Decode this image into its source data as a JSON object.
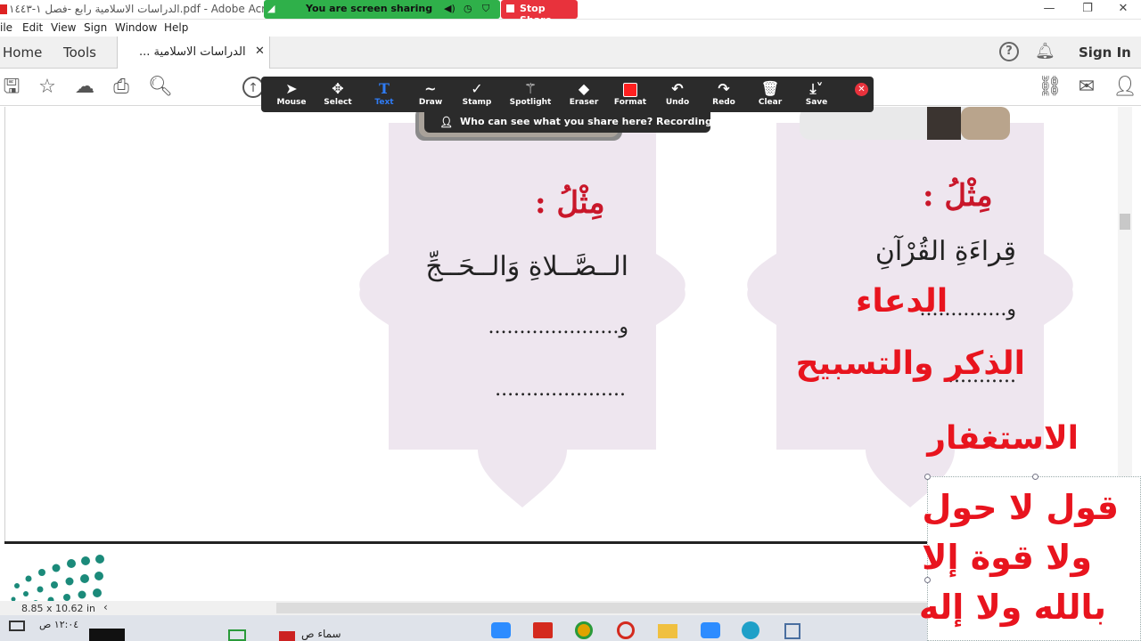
{
  "window": {
    "title": "الدراسات الاسلامية رابع -فصل ١-١٤٤٣.pdf - Adobe Acrobat Re",
    "menu": [
      "ile",
      "Edit",
      "View",
      "Sign",
      "Window",
      "Help"
    ]
  },
  "tabs": {
    "home": "Home",
    "tools": "Tools",
    "document": "الدراسات الاسلامية ...",
    "help": "?",
    "sign_in": "Sign In"
  },
  "share": {
    "sharing_label": "You are screen sharing",
    "stop_label": "Stop Share",
    "recording_notice": "Who can see what you share here? Recording On"
  },
  "annotate_toolbar": [
    {
      "label": "Mouse",
      "icon": "cursor-icon"
    },
    {
      "label": "Select",
      "icon": "move-icon"
    },
    {
      "label": "Text",
      "icon": "text-icon"
    },
    {
      "label": "Draw",
      "icon": "draw-icon"
    },
    {
      "label": "Stamp",
      "icon": "check-icon"
    },
    {
      "label": "Spotlight",
      "icon": "wand-icon"
    },
    {
      "label": "Eraser",
      "icon": "eraser-icon"
    },
    {
      "label": "Format",
      "icon": "format-square-icon"
    },
    {
      "label": "Undo",
      "icon": "undo-icon"
    },
    {
      "label": "Redo",
      "icon": "redo-icon"
    },
    {
      "label": "Clear",
      "icon": "trash-icon"
    },
    {
      "label": "Save",
      "icon": "save-icon"
    }
  ],
  "page": {
    "left_card": {
      "example_label": "مِثْلُ :",
      "line1": "الــصَّــلاةِ وَالــحَــجِّ",
      "line2": "و.....................",
      "line3": "....................."
    },
    "right_card": {
      "example_label": "مِثْلُ :",
      "line1": "قِراءَةِ القُرْآنِ",
      "line2": "و..............",
      "line3": "..........."
    },
    "handwritten": {
      "doaa": "الدعاء",
      "dhikr": "الذكر والتسبيح",
      "istighfar": "الاستغفار",
      "box_line1": "قول لا حول",
      "box_line2": "ولا قوة إلا",
      "box_line3": "بالله ولا إله"
    }
  },
  "status": {
    "page_size": "8.85 x 10.62 in",
    "taskbar_time": "١٢:٠٤ ص",
    "taskbar_user": "سماء ص"
  },
  "colors": {
    "share_green": "#2fb04a",
    "stop_red": "#e8323c",
    "annotation_red": "#e8141e",
    "card_lavender": "#eee6ef",
    "logo_teal": "#1b8a7a",
    "text_tool_blue": "#2f7cf6"
  }
}
